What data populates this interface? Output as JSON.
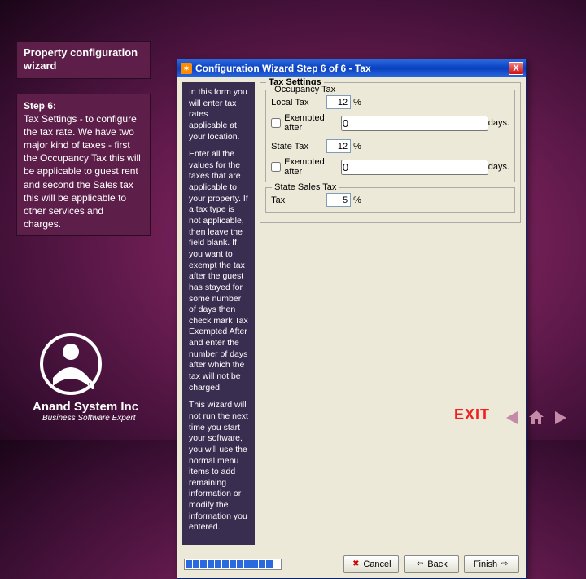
{
  "left": {
    "title": "Property configuration wizard",
    "step_label": "Step 6:",
    "step_text": "Tax Settings -  to configure the tax rate. We have two major kind of taxes -  first the Occupancy Tax this will be applicable to guest rent and second  the Sales tax this will be applicable to other services and charges."
  },
  "company": "Anand System Inc",
  "tagline": "Business Software Expert",
  "wizard": {
    "title": "Configuration Wizard Step 6 of 6 - Tax",
    "close": "X",
    "info1": "In this form you will enter tax rates applicable at your location.",
    "info2": "Enter all the values for the taxes that are applicable to your property. If a tax type is not applicable, then leave the field blank. If you want to exempt the tax after the guest has stayed for some number of days then check mark Tax Exempted After and enter the number of days after which the tax will not be charged.",
    "info3": "This wizard will not run the next time you start your software, you will use the normal menu items to add remaining information or modify the information you entered.",
    "tax_settings_legend": "Tax Settings",
    "occupancy_legend": "Occupancy Tax",
    "local_tax_label": "Local Tax",
    "local_tax_value": "12",
    "pct": "%",
    "exempted_label": "Exempted after",
    "exempted_value": "0",
    "days": "days.",
    "state_tax_label": "State Tax",
    "state_tax_value": "12",
    "state_exempted_value": "0",
    "sales_legend": "State Sales Tax",
    "sales_tax_label": "Tax",
    "sales_tax_value": "5",
    "btn_cancel": "Cancel",
    "btn_back": "Back",
    "btn_finish": "Finish"
  },
  "exit": "EXIT"
}
